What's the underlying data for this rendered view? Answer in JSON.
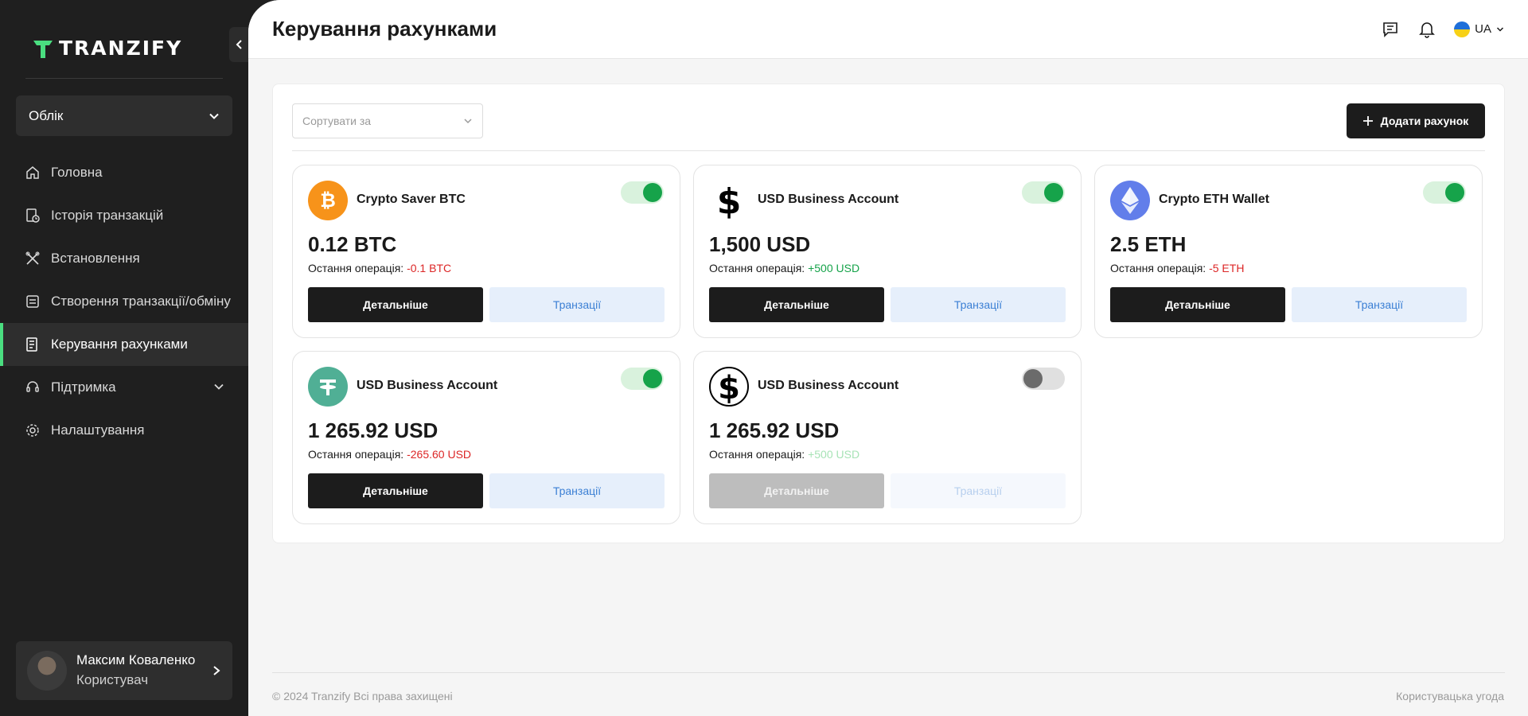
{
  "brand": {
    "name": "TRANZIFY",
    "accent": "#4ade80"
  },
  "sidebar": {
    "account_select": "Облік",
    "items": [
      {
        "label": "Головна",
        "icon": "home-icon"
      },
      {
        "label": "Історія транзакцій",
        "icon": "history-icon"
      },
      {
        "label": "Встановлення",
        "icon": "tools-icon"
      },
      {
        "label": "Створення транзакції/обміну",
        "icon": "exchange-icon"
      },
      {
        "label": "Керування рахунками",
        "icon": "accounts-icon",
        "active": true
      },
      {
        "label": "Підтримка",
        "icon": "headset-icon",
        "has_submenu": true
      },
      {
        "label": "Налаштування",
        "icon": "gear-icon"
      }
    ],
    "user": {
      "name": "Максим Коваленко",
      "role": "Користувач"
    }
  },
  "header": {
    "title": "Керування рахунками",
    "language": "UA"
  },
  "toolbar": {
    "sort_placeholder": "Сортувати за",
    "add_label": "Додати рахунок"
  },
  "cards": [
    {
      "name": "Crypto Saver BTC",
      "icon": "bitcoin-icon",
      "balance": "0.12 BTC",
      "last_label": "Остання операція:",
      "last_value": "-0.1 BTC",
      "enabled": true,
      "details_label": "Детальніше",
      "tx_label": "Транзації"
    },
    {
      "name": "USD Business Account",
      "icon": "dollar-icon",
      "balance": "1,500 USD",
      "last_label": "Остання операція:",
      "last_value": "+500 USD",
      "enabled": true,
      "details_label": "Детальніше",
      "tx_label": "Транзації"
    },
    {
      "name": "Crypto ETH Wallet",
      "icon": "ethereum-icon",
      "balance": "2.5 ETH",
      "last_label": "Остання операція:",
      "last_value": "-5 ETH",
      "enabled": true,
      "details_label": "Детальніше",
      "tx_label": "Транзації"
    },
    {
      "name": "USD Business Account",
      "icon": "tether-icon",
      "balance": "1 265.92 USD",
      "last_label": "Остання операція:",
      "last_value": "-265.60 USD",
      "enabled": true,
      "details_label": "Детальніше",
      "tx_label": "Транзації"
    },
    {
      "name": "USD Business Account",
      "icon": "dollar-circle-icon",
      "balance": "1 265.92 USD",
      "last_label": "Остання операція:",
      "last_value": "+500 USD",
      "enabled": false,
      "details_label": "Детальніше",
      "tx_label": "Транзації"
    }
  ],
  "footer": {
    "copyright": "© 2024 Tranzify Всі права захищені",
    "agreement": "Користувацька угода"
  }
}
